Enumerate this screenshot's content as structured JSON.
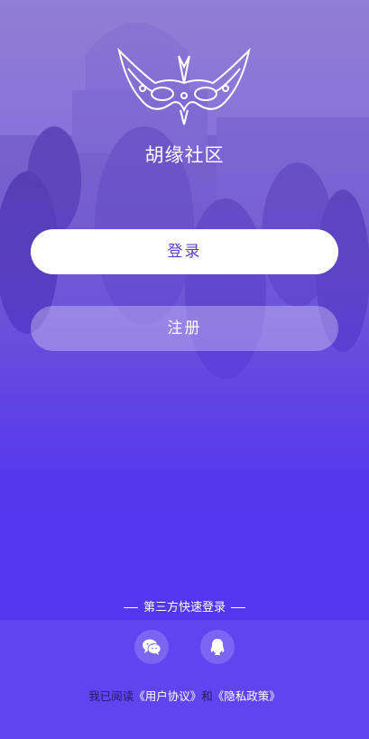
{
  "app": {
    "title": "胡缘社区"
  },
  "auth": {
    "login_label": "登录",
    "register_label": "注册"
  },
  "third_party": {
    "label": "第三方快速登录",
    "providers": [
      {
        "name": "wechat",
        "icon": "wechat-icon"
      },
      {
        "name": "qq",
        "icon": "qq-icon"
      }
    ]
  },
  "agreement": {
    "prefix": "我已阅读",
    "user_agreement": "《用户协议》",
    "conjunction": "和",
    "privacy_policy": "《隐私政策》"
  },
  "colors": {
    "accent": "#5b3fc9",
    "background": "#5436ee",
    "text_on_accent": "#ffffff"
  }
}
